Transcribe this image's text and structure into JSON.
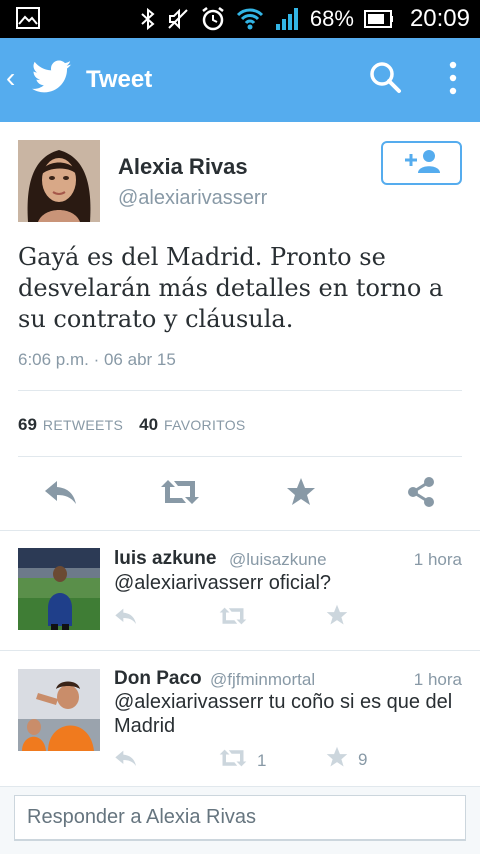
{
  "status_bar": {
    "battery": "68%",
    "time": "20:09"
  },
  "app_bar": {
    "title": "Tweet"
  },
  "tweet": {
    "author_name": "Alexia Rivas",
    "author_handle": "@alexiarivasserr",
    "text": "Gayá es del Madrid. Pronto se desvelarán más detalles en torno a su contrato y cláusula.",
    "timestamp": "6:06 p.m. · 06 abr 15",
    "retweets_count": "69",
    "retweets_label": "RETWEETS",
    "favorites_count": "40",
    "favorites_label": "FAVORITOS"
  },
  "replies": [
    {
      "name": "luis azkune",
      "handle": "@luisazkune",
      "time": "1 hora",
      "text": "@alexiarivasserr oficial?",
      "retweet_count": "",
      "favorite_count": ""
    },
    {
      "name": "Don Paco",
      "handle": "@fjfminmortal",
      "time": "1 hora",
      "text": "@alexiarivasserr tu coño si es que del Madrid",
      "retweet_count": "1",
      "favorite_count": "9"
    }
  ],
  "reply_box": {
    "placeholder": "Responder a Alexia Rivas"
  },
  "colors": {
    "brand": "#55acee",
    "text": "#292f33",
    "muted": "#8899a6",
    "divider": "#e1e8ed"
  }
}
